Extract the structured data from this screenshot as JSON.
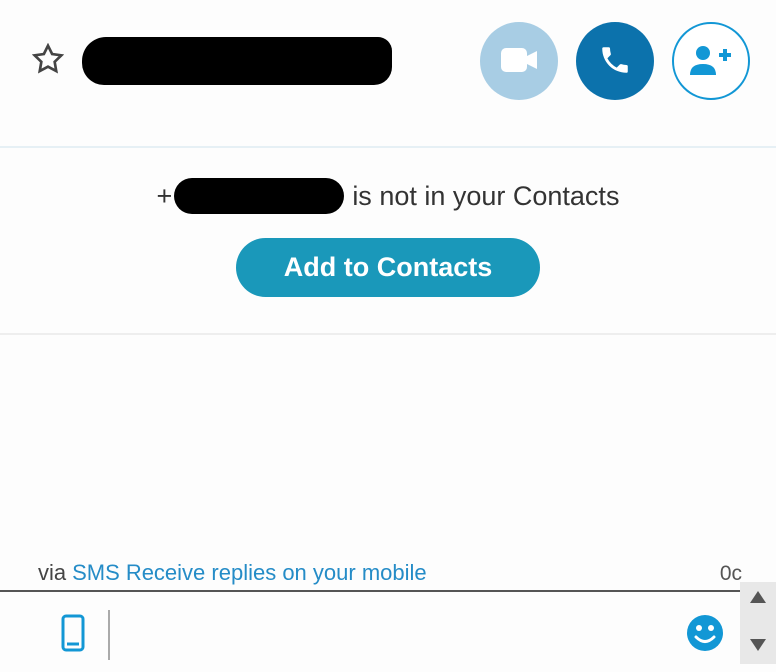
{
  "header": {
    "contact_name": "[redacted]"
  },
  "banner": {
    "prefix": "+",
    "phone": "[redacted]",
    "suffix": "is not in your Contacts",
    "add_button": "Add to Contacts"
  },
  "composer": {
    "via_label": "via",
    "sms_link": "SMS",
    "receive_link": "Receive replies on your mobile",
    "char_count": "0c",
    "input_value": ""
  },
  "icons": {
    "star": "star-icon",
    "video": "video-icon",
    "phone": "phone-icon",
    "add_person": "add-person-icon",
    "mobile": "mobile-icon",
    "emoji": "emoji-icon"
  },
  "colors": {
    "primary": "#1a98ba",
    "primary_dark": "#0c72ac",
    "primary_light": "#a8cde4",
    "link": "#258cc7"
  }
}
